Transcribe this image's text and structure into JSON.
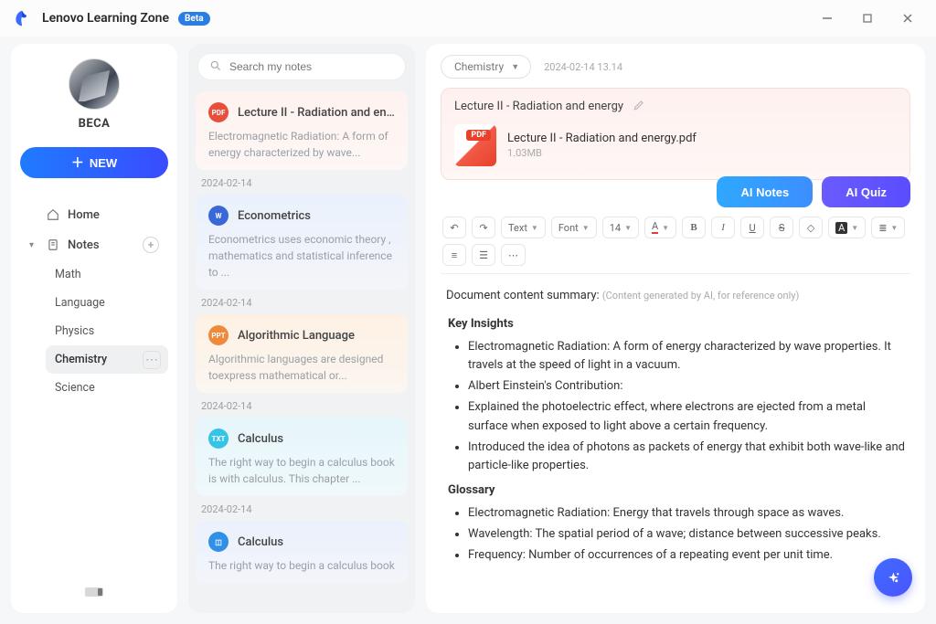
{
  "app": {
    "title": "Lenovo Learning Zone",
    "badge": "Beta"
  },
  "sidebar": {
    "username": "BECA",
    "new_label": "NEW",
    "home_label": "Home",
    "notes_label": "Notes",
    "sub": {
      "math": "Math",
      "language": "Language",
      "physics": "Physics",
      "chemistry": "Chemistry",
      "science": "Science"
    }
  },
  "search": {
    "placeholder": "Search my notes"
  },
  "notes": {
    "n0": {
      "title": "Lecture II - Radiation and ene...",
      "excerpt": "Electromagnetic Radiation: A form of energy characterized by wave...",
      "date": "2024-02-14"
    },
    "n1": {
      "title": "Econometrics",
      "excerpt": "Econometrics uses economic theory , mathematics  and statistical inference to ...",
      "date": "2024-02-14"
    },
    "n2": {
      "title": "Algorithmic Language",
      "excerpt": "Algorithmic languages are designed toexpress mathematical or...",
      "date": "2024-02-14"
    },
    "n3": {
      "title": "Calculus",
      "excerpt": "The right way to begin a calculus book is with calculus. This chapter ...",
      "date": "2024-02-14"
    },
    "n4": {
      "title": "Calculus",
      "excerpt": "The right way to begin a calculus book"
    }
  },
  "content": {
    "category": "Chemistry",
    "timestamp": "2024-02-14 13.14",
    "title": "Lecture II - Radiation and energy",
    "filename": "Lecture II - Radiation and energy.pdf",
    "filesize": "1.03MB",
    "filetag": "PDF",
    "ai_notes_label": "AI Notes",
    "ai_quiz_label": "AI Quiz"
  },
  "toolbar": {
    "text": "Text",
    "font": "Font",
    "size": "14"
  },
  "doc": {
    "summary_label": "Document content summary:",
    "summary_hint": "(Content generated by AI, for reference only)",
    "insights_h": "Key Insights",
    "i1": "Electromagnetic Radiation: A form of energy characterized by wave properties. It travels at the speed of light in a vacuum.",
    "i2": "Albert Einstein's Contribution:",
    "i3": "Explained the photoelectric effect, where electrons are ejected from a metal surface when exposed to light above a certain frequency.",
    "i4": "Introduced the idea of photons as packets of energy that exhibit both wave-like and particle-like properties.",
    "glossary_h": "Glossary",
    "g1": "Electromagnetic Radiation: Energy that travels through space as waves.",
    "g2": "Wavelength: The spatial period of a wave; distance between successive peaks.",
    "g3": "Frequency: Number of occurrences of a repeating event per unit time."
  }
}
